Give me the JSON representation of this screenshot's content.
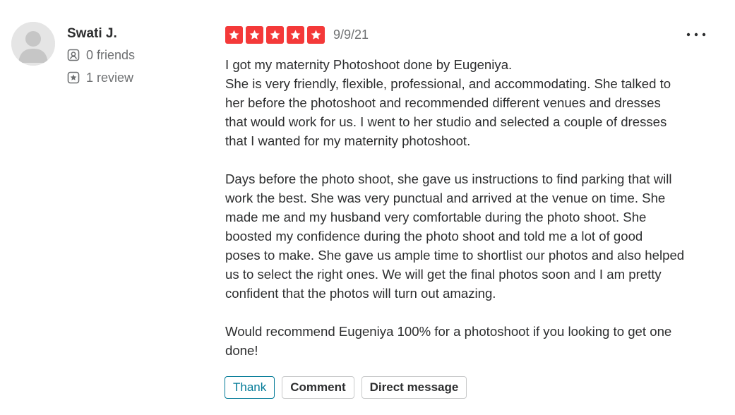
{
  "user": {
    "name": "Swati J.",
    "friends": "0 friends",
    "reviews": "1 review"
  },
  "review": {
    "rating": 5,
    "max_rating": 5,
    "date": "9/9/21",
    "paragraphs": [
      {
        "lines": [
          "I got my maternity Photoshoot done by Eugeniya.",
          "She is very friendly, flexible, professional, and accommodating. She talked to",
          "her before the photoshoot and recommended different venues and dresses",
          "that would work for us. I went to her studio and selected a couple of dresses",
          "that I wanted for my maternity photoshoot."
        ]
      },
      {
        "lines": [
          "Days before the photo shoot, she gave us instructions to find parking that will",
          "work the best. She was very punctual and arrived at the venue on time. She",
          "made me and my husband very comfortable during the photo shoot. She",
          "boosted my confidence during the photo shoot and told me a lot of good",
          "poses to make. She gave us ample time to shortlist our photos and also helped",
          "us to select the right ones. We will get the final photos soon and I am pretty",
          "confident that the photos will turn out amazing."
        ]
      },
      {
        "lines": [
          "Would recommend Eugeniya 100% for a photoshoot if you looking to get one",
          "done!"
        ]
      }
    ]
  },
  "actions": {
    "thank_label": "Thank",
    "comment_label": "Comment",
    "message_label": "Direct message"
  },
  "icons": {
    "friends": "friends-icon",
    "reviews": "review-star-icon",
    "more": "more-options-icon",
    "star": "star-icon"
  },
  "colors": {
    "star_fill": "#f43939",
    "thank_accent": "#027a97",
    "secondary_text": "#6e7072",
    "primary_text": "#2d2e2f"
  }
}
